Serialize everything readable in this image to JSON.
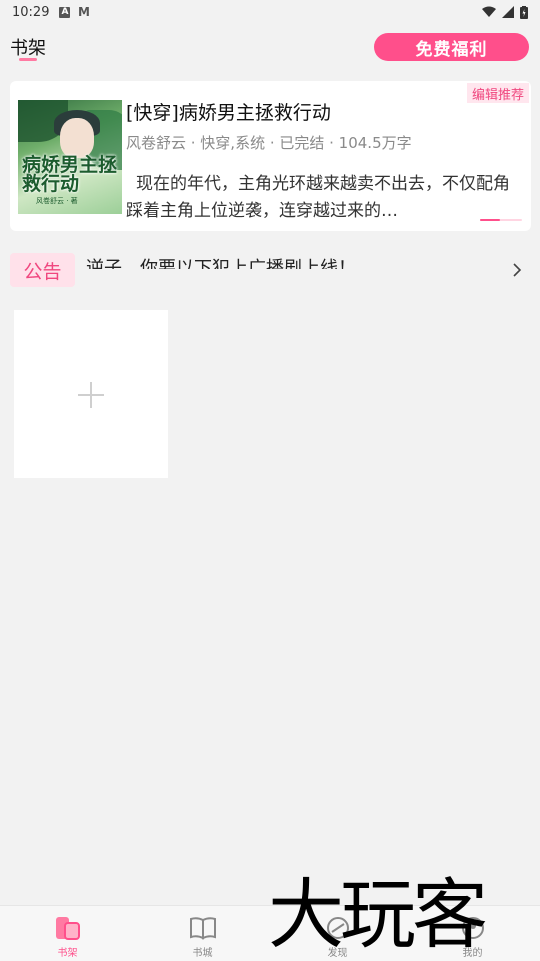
{
  "status_bar": {
    "time": "10:29",
    "notif_a": "A",
    "notif_m": "M"
  },
  "header": {
    "title": "书架",
    "welfare_button": "免费福利"
  },
  "recommendation": {
    "tag": "编辑推荐",
    "book_title": "[快穿]病娇男主拯救行动",
    "meta": "风卷舒云 · 快穿,系统 · 已完结 · 104.5万字",
    "description": "现在的年代，主角光环越来越卖不出去，不仅配角踩着主角上位逆袭，连穿越过来的…",
    "cover_title": "病娇男主拯救行动",
    "cover_sub": "风卷舒云 · 著"
  },
  "notice": {
    "badge": "公告",
    "text": "逆子，你要以下犯上广播剧上线！"
  },
  "shelf": {
    "add_label": "添加书籍"
  },
  "bottom_nav": {
    "items": [
      {
        "label": "书架",
        "icon": "bookshelf-icon",
        "active": true
      },
      {
        "label": "书城",
        "icon": "open-book-icon",
        "active": false
      },
      {
        "label": "发现",
        "icon": "discover-icon",
        "active": false
      },
      {
        "label": "我的",
        "icon": "profile-icon",
        "active": false
      }
    ]
  },
  "watermark": "大玩客",
  "colors": {
    "accent": "#ff4f8b",
    "accent_light": "#ffe1ea",
    "background": "#f2f2f2"
  }
}
